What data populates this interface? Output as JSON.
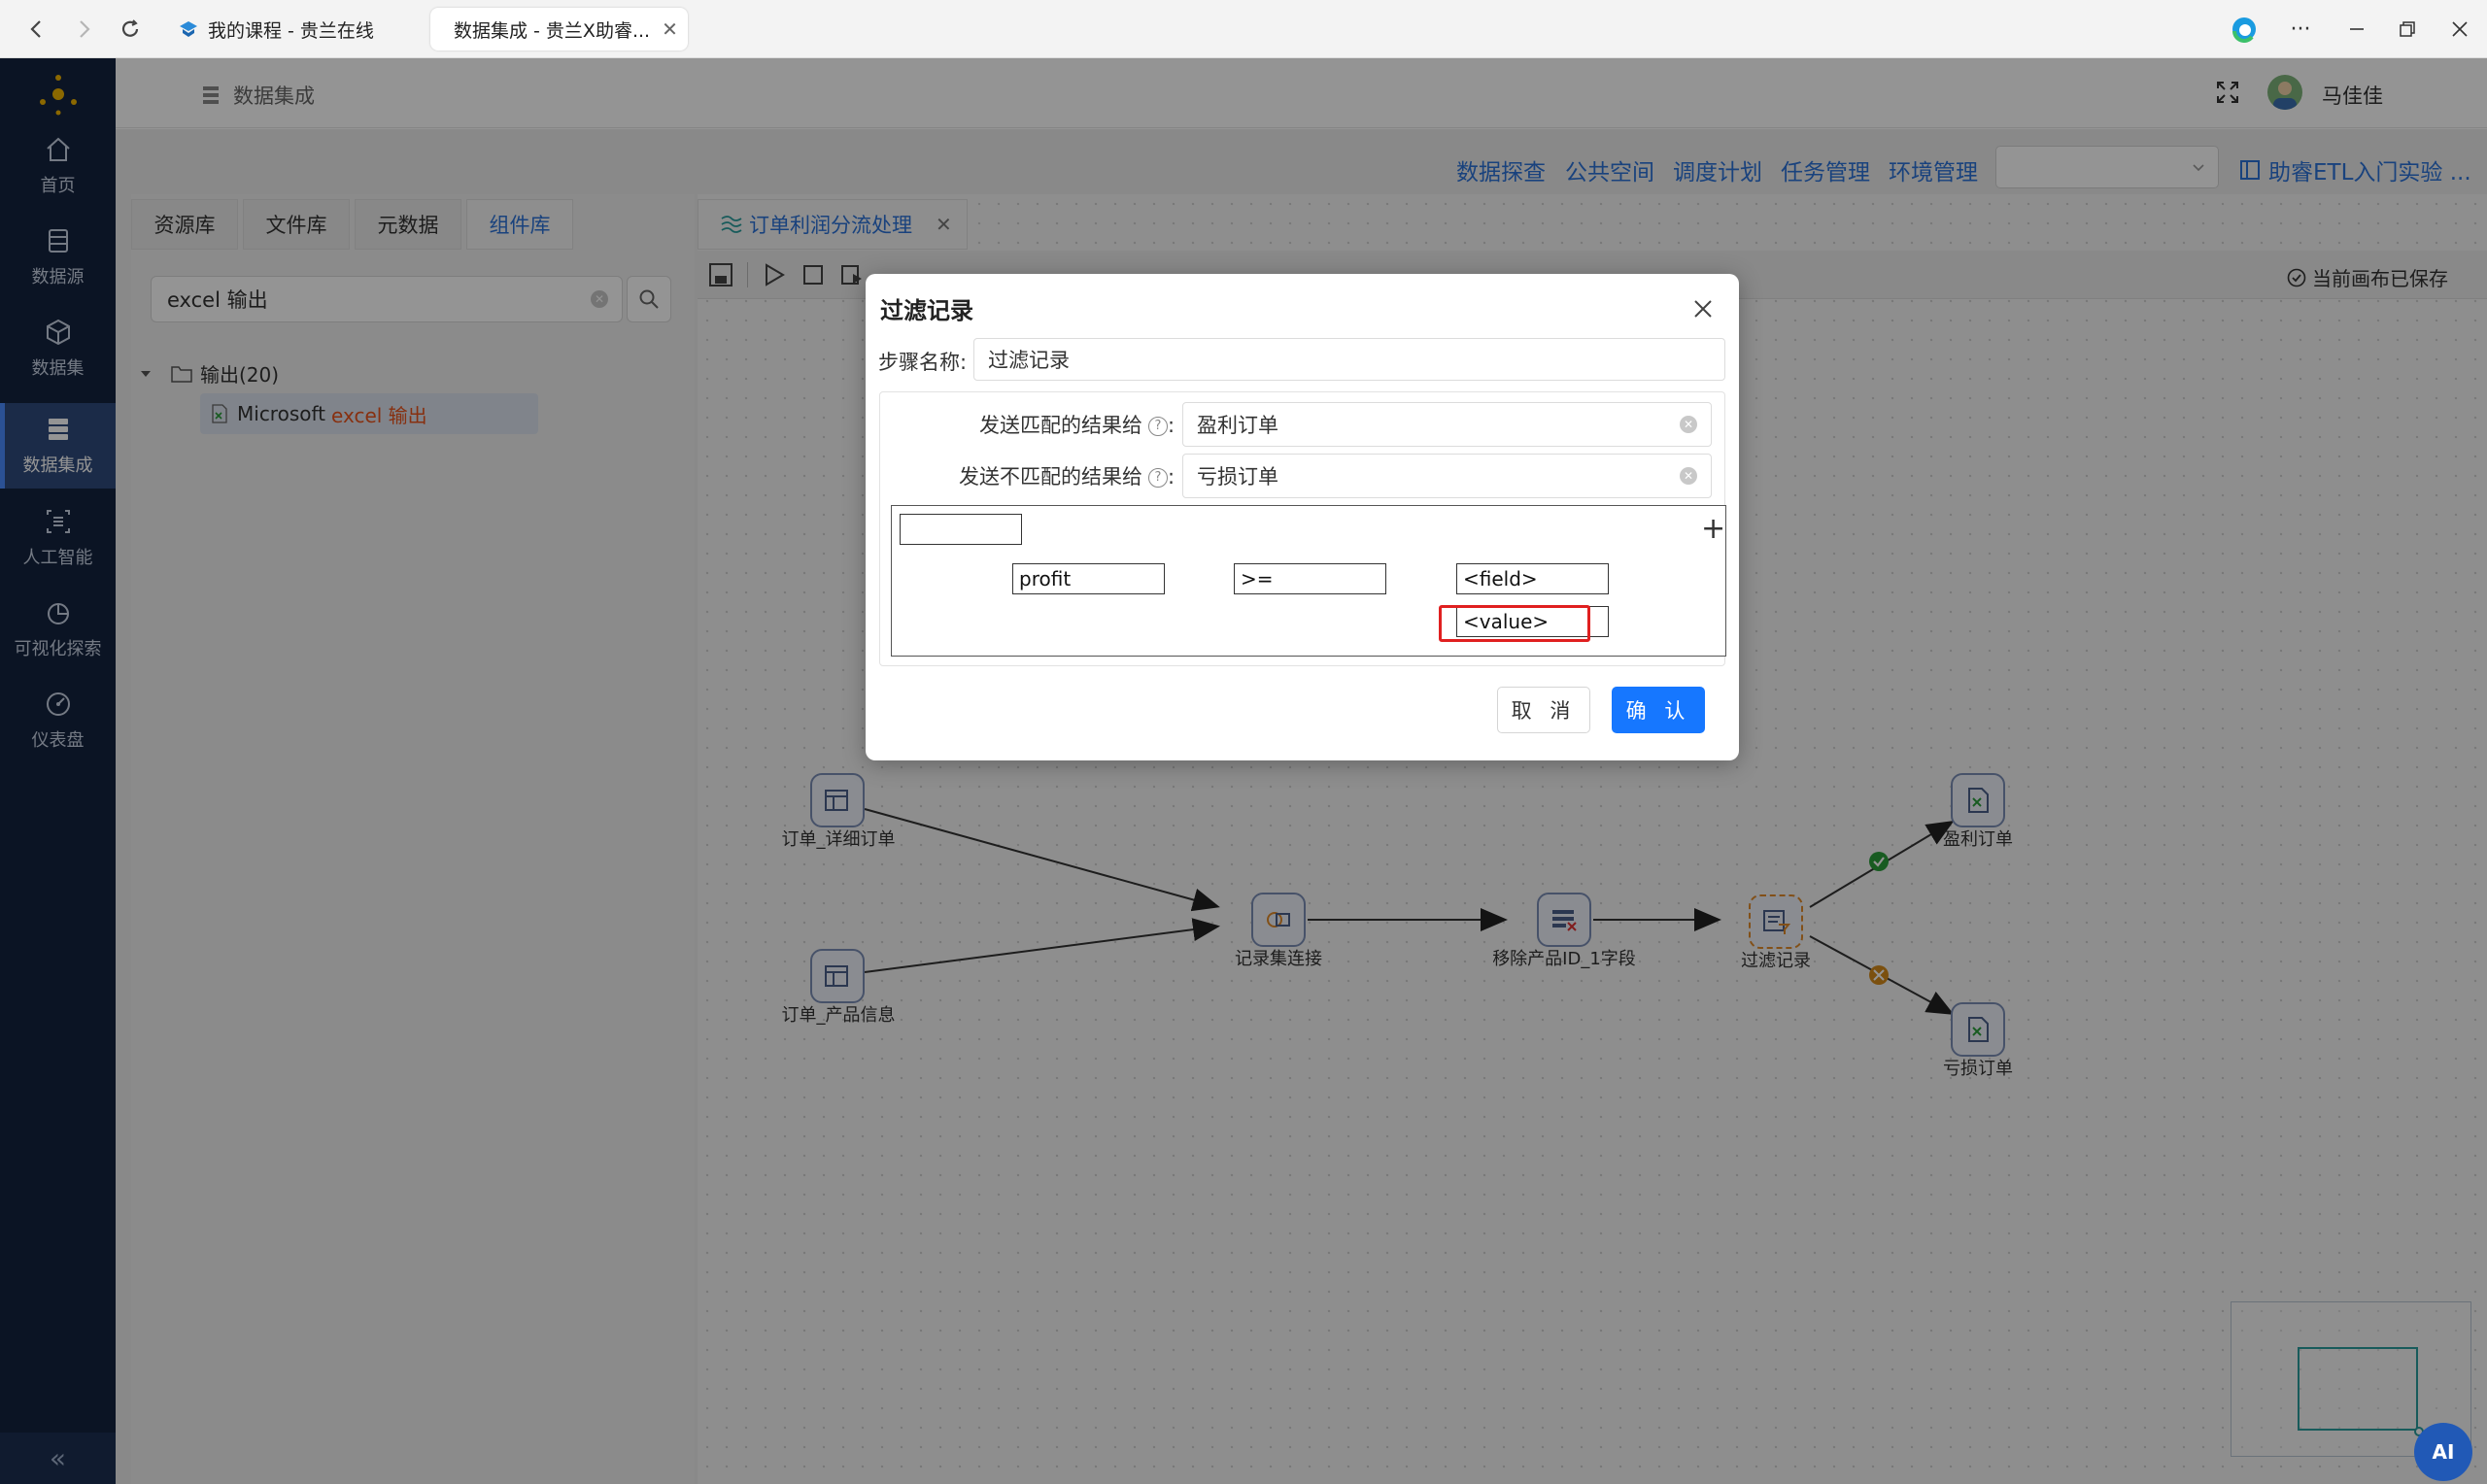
{
  "browser": {
    "tabs": [
      {
        "label": "我的课程 - 贵兰在线"
      },
      {
        "label": "数据集成 - 贵兰X助睿..."
      }
    ],
    "close_glyph": "✕",
    "more_glyph": "···"
  },
  "sidebar": {
    "items": [
      {
        "label": "首页",
        "icon": "home-icon"
      },
      {
        "label": "数据源",
        "icon": "database-icon"
      },
      {
        "label": "数据集",
        "icon": "cube-icon"
      },
      {
        "label": "数据集成",
        "icon": "server-icon"
      },
      {
        "label": "人工智能",
        "icon": "ai-icon"
      },
      {
        "label": "可视化探索",
        "icon": "pie-chart-icon"
      },
      {
        "label": "仪表盘",
        "icon": "gauge-icon"
      }
    ],
    "active": "数据集成",
    "collapse_glyph": "«"
  },
  "header": {
    "breadcrumb": "数据集成",
    "user_name": "马佳佳"
  },
  "top_menu": {
    "links": [
      "数据探查",
      "公共空间",
      "调度计划",
      "任务管理",
      "环境管理"
    ],
    "project": "助睿ETL入门实验 ..."
  },
  "left_panel": {
    "tabs": [
      "资源库",
      "文件库",
      "元数据",
      "组件库"
    ],
    "active_tab": "组件库",
    "search_value": "excel 输出",
    "tree": {
      "folder": "输出(20)",
      "item_prefix": "Microsoft ",
      "item_highlight": "excel 输出"
    }
  },
  "canvas": {
    "tab_label": "订单利润分流处理",
    "saved_status": "当前画布已保存",
    "nodes": [
      {
        "label": "订单_详细订单"
      },
      {
        "label": "订单_产品信息"
      },
      {
        "label": "记录集连接"
      },
      {
        "label": "移除产品ID_1字段"
      },
      {
        "label": "过滤记录"
      },
      {
        "label": "盈利订单"
      },
      {
        "label": "亏损订单"
      }
    ]
  },
  "dialog": {
    "title": "过滤记录",
    "step_name_label": "步骤名称:",
    "step_name_value": "过滤记录",
    "match_label": "发送匹配的结果给",
    "match_value": "盈利订单",
    "nomatch_label": "发送不匹配的结果给",
    "nomatch_value": "亏损订单",
    "help_glyph": "?",
    "colon": ":",
    "plus_glyph": "+",
    "condition": {
      "header_value": "",
      "field": "profit",
      "operator": ">=",
      "right_field": "<field>",
      "right_value": "<value>"
    },
    "cancel_label": "取 消",
    "ok_label": "确 认"
  },
  "ai_button": "AI",
  "colors": {
    "accent": "#1677ff",
    "link": "#2c72d8",
    "sidebar_bg": "#14233f",
    "highlight_box": "#e02020",
    "success": "#2a9d3a",
    "warning": "#d48a1a"
  }
}
